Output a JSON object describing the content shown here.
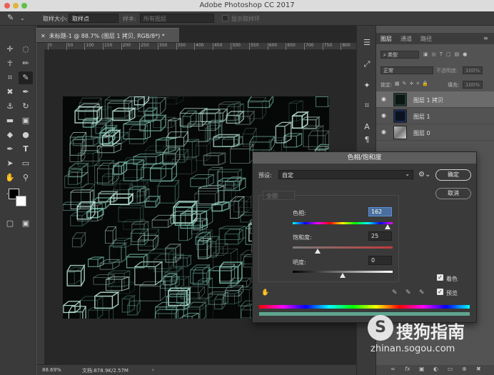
{
  "app": {
    "window_title": "Adobe Photoshop CC 2017"
  },
  "options_bar": {
    "sample_size_label": "取样大小:",
    "sample_size_value": "取样点",
    "sample_label": "样本:",
    "sample_value": "所有图层",
    "show_ring_label": "显示取样环"
  },
  "document": {
    "tab_title": "未标题-1 @ 88.7% (图层 1 拷贝, RGB/8*) *",
    "ruler_ticks": [
      "0",
      "50",
      "100",
      "150",
      "200",
      "250",
      "300",
      "350",
      "400",
      "450",
      "500",
      "550",
      "600",
      "650",
      "700",
      "750",
      "800"
    ],
    "status_zoom": "88.69%",
    "status_doc": "文档:878.9K/2.57M"
  },
  "layers_panel": {
    "tabs": [
      "图层",
      "通道",
      "路径"
    ],
    "filter_label": "类型",
    "blend_mode": "正常",
    "opacity_label": "不透明度:",
    "opacity_value": "100%",
    "lock_label": "锁定:",
    "fill_label": "填充:",
    "fill_value": "100%",
    "layers": [
      {
        "name": "图层 1 拷贝",
        "selected": true
      },
      {
        "name": "图层 1",
        "selected": false
      },
      {
        "name": "图层 0",
        "selected": false
      }
    ],
    "footer_icons": [
      "link-icon",
      "fx-icon",
      "mask-icon",
      "adjustment-icon",
      "folder-icon",
      "new-layer-icon",
      "trash-icon"
    ]
  },
  "hue_saturation_dialog": {
    "title": "色相/饱和度",
    "preset_label": "预设:",
    "preset_value": "自定",
    "ok_label": "确定",
    "cancel_label": "取消",
    "channel_value": "全图",
    "hue_label": "色相:",
    "hue_value": "162",
    "hue_min": -180,
    "hue_max": 180,
    "saturation_label": "饱和度:",
    "saturation_value": "25",
    "saturation_min": 0,
    "saturation_max": 100,
    "lightness_label": "明度:",
    "lightness_value": "0",
    "lightness_min": -100,
    "lightness_max": 100,
    "colorize_label": "着色",
    "colorize_checked": true,
    "preview_label": "预览",
    "preview_checked": true
  },
  "watermark": {
    "logo_letter": "S",
    "name": "搜狗指南",
    "url": "zhinan.sogou.com"
  }
}
